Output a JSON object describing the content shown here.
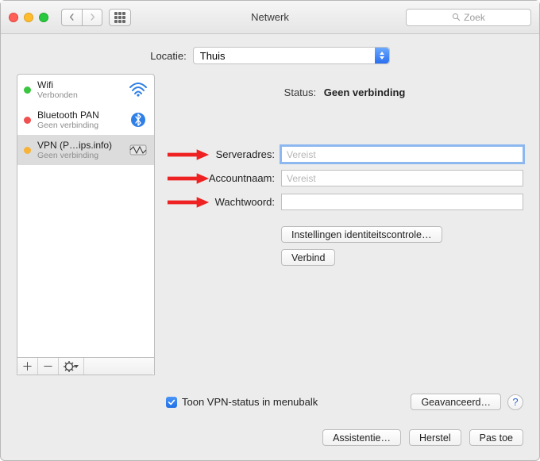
{
  "window": {
    "title": "Netwerk"
  },
  "search": {
    "placeholder": "Zoek"
  },
  "location": {
    "label": "Locatie:",
    "value": "Thuis"
  },
  "sidebar": {
    "items": [
      {
        "name": "Wifi",
        "sub": "Verbonden",
        "dot": "green",
        "icon": "wifi"
      },
      {
        "name": "Bluetooth PAN",
        "sub": "Geen verbinding",
        "dot": "red",
        "icon": "bluetooth"
      },
      {
        "name": "VPN (P…ips.info)",
        "sub": "Geen verbinding",
        "dot": "orange",
        "icon": "vpn"
      }
    ]
  },
  "status": {
    "label": "Status:",
    "value": "Geen verbinding"
  },
  "form": {
    "server": {
      "label": "Serveradres:",
      "placeholder": "Vereist",
      "value": ""
    },
    "account": {
      "label": "Accountnaam:",
      "placeholder": "Vereist",
      "value": ""
    },
    "password": {
      "label": "Wachtwoord:",
      "placeholder": "",
      "value": ""
    }
  },
  "buttons": {
    "authSettings": "Instellingen identiteitscontrole…",
    "connect": "Verbind",
    "advanced": "Geavanceerd…",
    "assist": "Assistentie…",
    "revert": "Herstel",
    "apply": "Pas toe"
  },
  "checkbox": {
    "label": "Toon VPN-status in menubalk",
    "checked": true
  }
}
